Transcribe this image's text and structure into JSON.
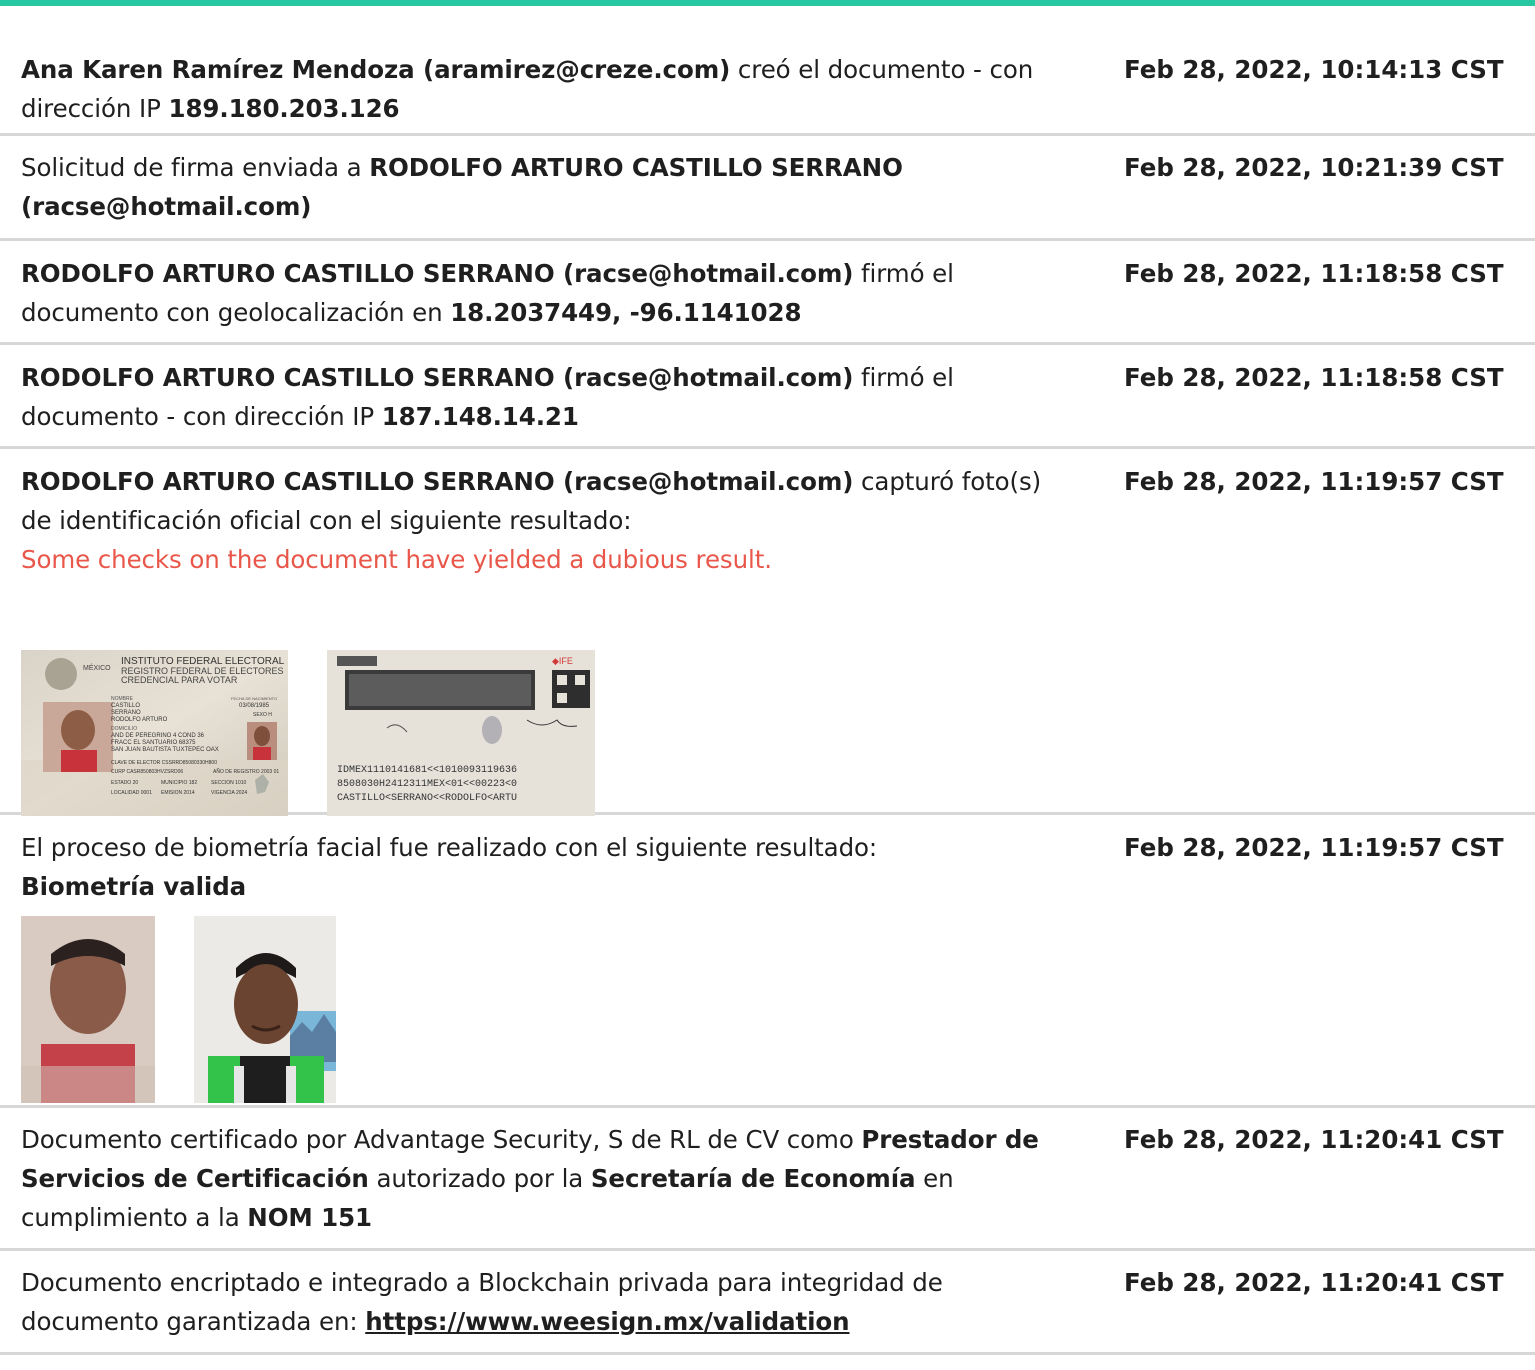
{
  "entries": [
    {
      "actor": "Ana Karen Ramírez Mendoza (aramirez@creze.com)",
      "action": " creó el documento - con dirección IP ",
      "ip": "189.180.203.126",
      "timestamp": "Feb 28, 2022, 10:14:13 CST"
    },
    {
      "prefix": "Solicitud de firma enviada a ",
      "recipient": "RODOLFO ARTURO CASTILLO SERRANO (racse@hotmail.com)",
      "timestamp": "Feb 28, 2022, 10:21:39 CST"
    },
    {
      "actor": "RODOLFO ARTURO CASTILLO SERRANO (racse@hotmail.com)",
      "action": " firmó el documento con geolocalización en ",
      "geo": "18.2037449, -96.1141028",
      "timestamp": "Feb 28, 2022, 11:18:58 CST"
    },
    {
      "actor": "RODOLFO ARTURO CASTILLO SERRANO (racse@hotmail.com)",
      "action": " firmó el documento - con dirección IP ",
      "ip": "187.148.14.21",
      "timestamp": "Feb 28, 2022, 11:18:58 CST"
    },
    {
      "actor": "RODOLFO ARTURO CASTILLO SERRANO (racse@hotmail.com)",
      "action": " capturó foto(s) de identificación oficial con el siguiente resultado:",
      "result": "Some checks on the document have yielded a dubious result.",
      "timestamp": "Feb 28, 2022, 11:19:57 CST",
      "id_front": {
        "title": "INSTITUTO FEDERAL ELECTORAL",
        "subtitle1": "REGISTRO FEDERAL DE ELECTORES",
        "subtitle2": "CREDENCIAL PARA VOTAR",
        "country": "MÉXICO",
        "name_label": "NOMBRE",
        "name1": "CASTILLO",
        "name2": "SERRANO",
        "name3": "RODOLFO ARTURO",
        "birth_label": "FECHA DE NACIMIENTO",
        "birth": "03/08/1985",
        "sex": "SEXO H",
        "domicile_label": "DOMICILIO",
        "addr1": "AND DE PEREGRINO 4 COND 36",
        "addr2": "FRACC EL SANTUARIO 68375",
        "addr3": "SAN JUAN BAUTISTA TUXTEPEC OAX",
        "elector": "CLAVE DE ELECTOR CSSRRD85080330H800",
        "curp": "CURP CASR850803HVZSRD06",
        "registro": "AÑO DE REGISTRO 2003 01",
        "estado": "ESTADO 20",
        "municipio": "MUNICIPIO 182",
        "seccion": "SECCION 1010",
        "localidad": "LOCALIDAD 0001",
        "emision": "EMISION 2014",
        "vigencia": "VIGENCIA 2024"
      },
      "id_back": {
        "logo": "◆IFE",
        "mrz1": "IDMEX1110141681<<1010093119636",
        "mrz2": "8508030H2412311MEX<01<<00223<0",
        "mrz3": "CASTILLO<SERRANO<<RODOLFO<ARTU"
      }
    },
    {
      "text": "El proceso de biometría facial fue realizado con el siguiente resultado:",
      "result": "Biometría valida",
      "timestamp": "Feb 28, 2022, 11:19:57 CST"
    },
    {
      "prefix": "Documento certificado por Advantage Security, S de RL de CV como ",
      "bold1": "Prestador de Servicios de Certificación",
      "mid": " autorizado por la ",
      "bold2": "Secretaría de Economía",
      "mid2": " en cumplimiento a la ",
      "bold3": "NOM 151",
      "timestamp": "Feb 28, 2022, 11:20:41 CST"
    },
    {
      "prefix": "Documento encriptado e integrado a Blockchain privada para integridad de documento garantizada en: ",
      "link": "https://www.weesign.mx/validation",
      "timestamp": "Feb 28, 2022, 11:20:41 CST"
    }
  ],
  "colors": {
    "accent": "#26c7a1",
    "dubious": "#e8574a",
    "divider": "#d7d7d7"
  }
}
